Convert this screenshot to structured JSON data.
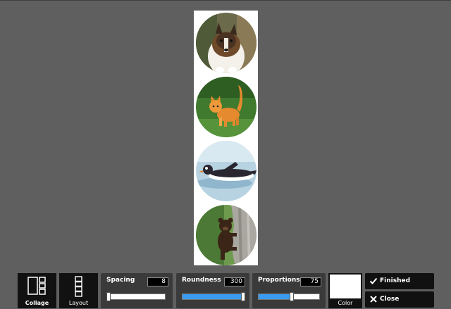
{
  "collage": {
    "background": "#ffffff",
    "photos": [
      "dog",
      "cat",
      "penguin",
      "bear"
    ]
  },
  "toolbar": {
    "collage_label": "Collage",
    "layout_label": "Layout",
    "spacing": {
      "title": "Spacing",
      "value": "8",
      "level": 0.03
    },
    "roundness": {
      "title": "Roundness",
      "value": "300",
      "level": 1.0
    },
    "proportions": {
      "title": "Proportions",
      "value": "75",
      "level": 0.55
    },
    "color_label": "Color",
    "color_value": "#ffffff",
    "finished_label": "Finished",
    "close_label": "Close"
  },
  "colors": {
    "background": "#5f5f5f",
    "accent": "#3a9cf0",
    "tile": "#111111",
    "panel": "#3a3a3a"
  },
  "icons": [
    "collage-icon",
    "layout-icon",
    "check-icon",
    "close-icon"
  ]
}
